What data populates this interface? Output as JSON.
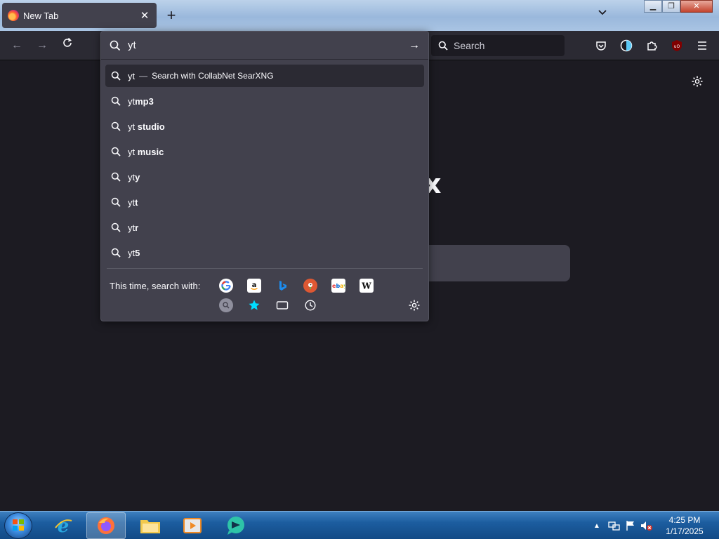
{
  "tab": {
    "title": "New Tab",
    "close_glyph": "✕"
  },
  "newtab_glyph": "+",
  "tablist_glyph": "⌄",
  "window_controls": {
    "minimize": "▁",
    "restore": "❐",
    "close": "✕"
  },
  "nav": {
    "back": "←",
    "forward": "→",
    "reload": "⟳"
  },
  "searchbar": {
    "label": "Search"
  },
  "urlbar": {
    "value": "yt",
    "go_glyph": "→"
  },
  "results": [
    {
      "prefix": "yt",
      "bold": "",
      "action": "Search with CollabNet SearXNG",
      "selected": true
    },
    {
      "prefix": "yt",
      "bold": "mp3"
    },
    {
      "prefix": "yt ",
      "bold": "studio"
    },
    {
      "prefix": "yt ",
      "bold": "music"
    },
    {
      "prefix": "yt",
      "bold": "y"
    },
    {
      "prefix": "yt",
      "bold": "t"
    },
    {
      "prefix": "yt",
      "bold": "r"
    },
    {
      "prefix": "yt",
      "bold": "5"
    }
  ],
  "oneoff": {
    "label": "This time, search with:",
    "engines": [
      "google-icon",
      "amazon-icon",
      "bing-icon",
      "duckduckgo-icon",
      "ebay-icon",
      "wikipedia-icon"
    ],
    "modes": [
      "search-icon",
      "bookmarks-icon",
      "tabs-icon",
      "history-icon"
    ]
  },
  "page": {
    "logo_fragment": "x"
  },
  "clock": {
    "time": "4:25 PM",
    "date": "1/17/2025"
  },
  "colors": {
    "panel": "#42414d",
    "toolbar": "#2b2a33",
    "page": "#1c1b22",
    "accent": "#00ddff"
  }
}
